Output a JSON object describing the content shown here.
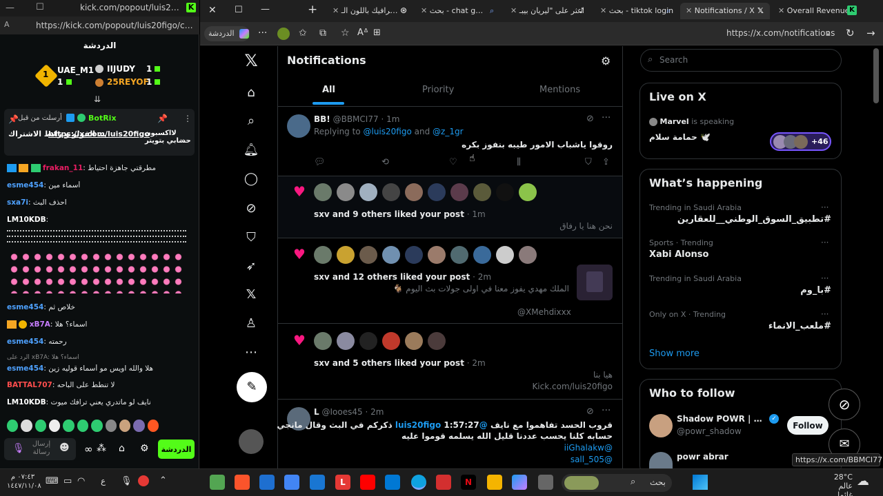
{
  "left_window": {
    "url": "https://kick.com/popout/luis20figo/chat",
    "title_url": "kick.com/popout/luis20figo/chat",
    "chat_header": "الدردشة",
    "leaderboard": [
      {
        "name": "UAE_M1",
        "count": "1"
      },
      {
        "name": "IIJUDY",
        "count": "1"
      },
      {
        "name": "25REYOF",
        "count": "1"
      }
    ],
    "pinned": {
      "by": "BotRix",
      "sent_by_prefix": "أرسلت من قبل",
      "text_prefix": "لااكسبون حسابي بتويتر",
      "link": "https://x.com/luis20figo",
      "text_suffix": "الفولو و رابط الاشتراك ..."
    },
    "messages": [
      {
        "user": "frakan_11",
        "text": "مطرقتي جاهزة احتياط",
        "color": "#e91e63"
      },
      {
        "user": "esme454",
        "text": "أسماء مين",
        "color": "#4ea1ff"
      },
      {
        "user": "sxa7i",
        "text": "احذف البث",
        "color": "#4ea1ff"
      },
      {
        "user": "LM10KDB",
        "text": "",
        "color": "#ffffff"
      },
      {
        "user": "esme454",
        "text": "خلاص ثم",
        "color": "#4ea1ff"
      },
      {
        "user": "xB7A",
        "text": "اسماء؟ هلا",
        "color": "#c77dff"
      },
      {
        "user": "esme454",
        "text": "رحمته",
        "color": "#4ea1ff"
      },
      {
        "user": "esme454",
        "text": "هلا والله اويس مو أسماء قوليه زين",
        "color": "#4ea1ff",
        "reply": "الرد على xB7A: اسماء؟ هلا"
      },
      {
        "user": "BATTAL707",
        "text": "لا تنطط على الباحه",
        "color": "#ff4d4d"
      },
      {
        "user": "LM10KDB",
        "text": "نايف لو ماتدري يعني ترافك ميوت",
        "color": "#ffffff"
      }
    ],
    "input_placeholder": "إرسال رسالة",
    "chat_button": "الدردشة"
  },
  "browser": {
    "tabs": [
      {
        "label": "Overall Revenue -"
      },
      {
        "label": "Notifications / X",
        "active": true
      },
      {
        "label": "بحث - tiktok login"
      },
      {
        "label": "اعثر على \"ليريان بيبـ"
      },
      {
        "label": "بحث - chat gbt ai"
      },
      {
        "label": "انفوجرافيك باللون الـ"
      }
    ],
    "profile_label": "الدردشة",
    "url": "https://x.com/notifications"
  },
  "x": {
    "page_title": "Notifications",
    "tabs": [
      "All",
      "Priority",
      "Mentions"
    ],
    "active_tab": "All",
    "post1": {
      "name": "BB!",
      "handle": "@BBMCI77",
      "time": "1m",
      "replying_prefix": "Replying to",
      "reply_to_1": "@luis20figo",
      "and_text": "and",
      "reply_to_2": "@z_1gr",
      "text": "روقوا ياشباب الامور طيبه بنفوز بكره"
    },
    "like1": {
      "text": "sxv and 9 others liked your post",
      "time": "1m",
      "quote": "نحن هنا يا رفاق"
    },
    "like2": {
      "text": "sxv and 12 others liked your post",
      "time": "2m",
      "quote": "الملك مهدي يفوز معنا في اولى جولات بث اليوم 🐐",
      "handle": "@XMehdixxx"
    },
    "like3": {
      "text": "sxv and 5 others liked your post",
      "time": "2m",
      "quote": "هيا بنا",
      "link": "Kick.com/luis20figo"
    },
    "post2": {
      "name": "L",
      "handle": "@Iooes45",
      "time": "2m",
      "text1": "قروب الحسد تفاهموا مع نايف",
      "mention": "@luis20figo",
      "text2": "1:57:27 ذكركم في البث وقال مانجي",
      "text3": "حسابه كلنا يحسب عددنا قليل الله يسلمه قوموا عليه",
      "mention2": "@iiGhalakw",
      "mention3": "@505_sall"
    },
    "search_placeholder": "Search",
    "live": {
      "title": "Live on X",
      "host": "Marvel",
      "speaking": "is speaking",
      "space_title": "حمامة سلام 🕊️",
      "extra_count": "+46"
    },
    "happening": {
      "title": "What’s happening",
      "trends": [
        {
          "context": "Trending in Saudi Arabia",
          "name": "#تطبيق_السوق_الوطني__للعقارين"
        },
        {
          "context": "Sports · Trending",
          "name": "Xabi Alonso"
        },
        {
          "context": "Trending in Saudi Arabia",
          "name": "#با_وم"
        },
        {
          "context": "Only on X · Trending",
          "name": "#ملعب_الانماء"
        }
      ],
      "show_more": "Show more"
    },
    "who_to_follow": {
      "title": "Who to follow",
      "users": [
        {
          "name": "Shadow POWR | edi...",
          "handle": "@powr_shadow",
          "button": "Follow"
        },
        {
          "name": "powr abrar",
          "handle": ""
        }
      ]
    },
    "status_link": "https://x.com/BBMCI77"
  },
  "taskbar": {
    "search_label": "بحث",
    "weather_temp": "28°C",
    "weather_desc": "عالم غائما",
    "clock_time": "٠٧:٤٣ م",
    "clock_date": "١٤٤٧/١١/٠٨"
  },
  "colors": {
    "x_blue": "#1d9bf0",
    "like_pink": "#f91880",
    "kick_green": "#53fc18"
  }
}
